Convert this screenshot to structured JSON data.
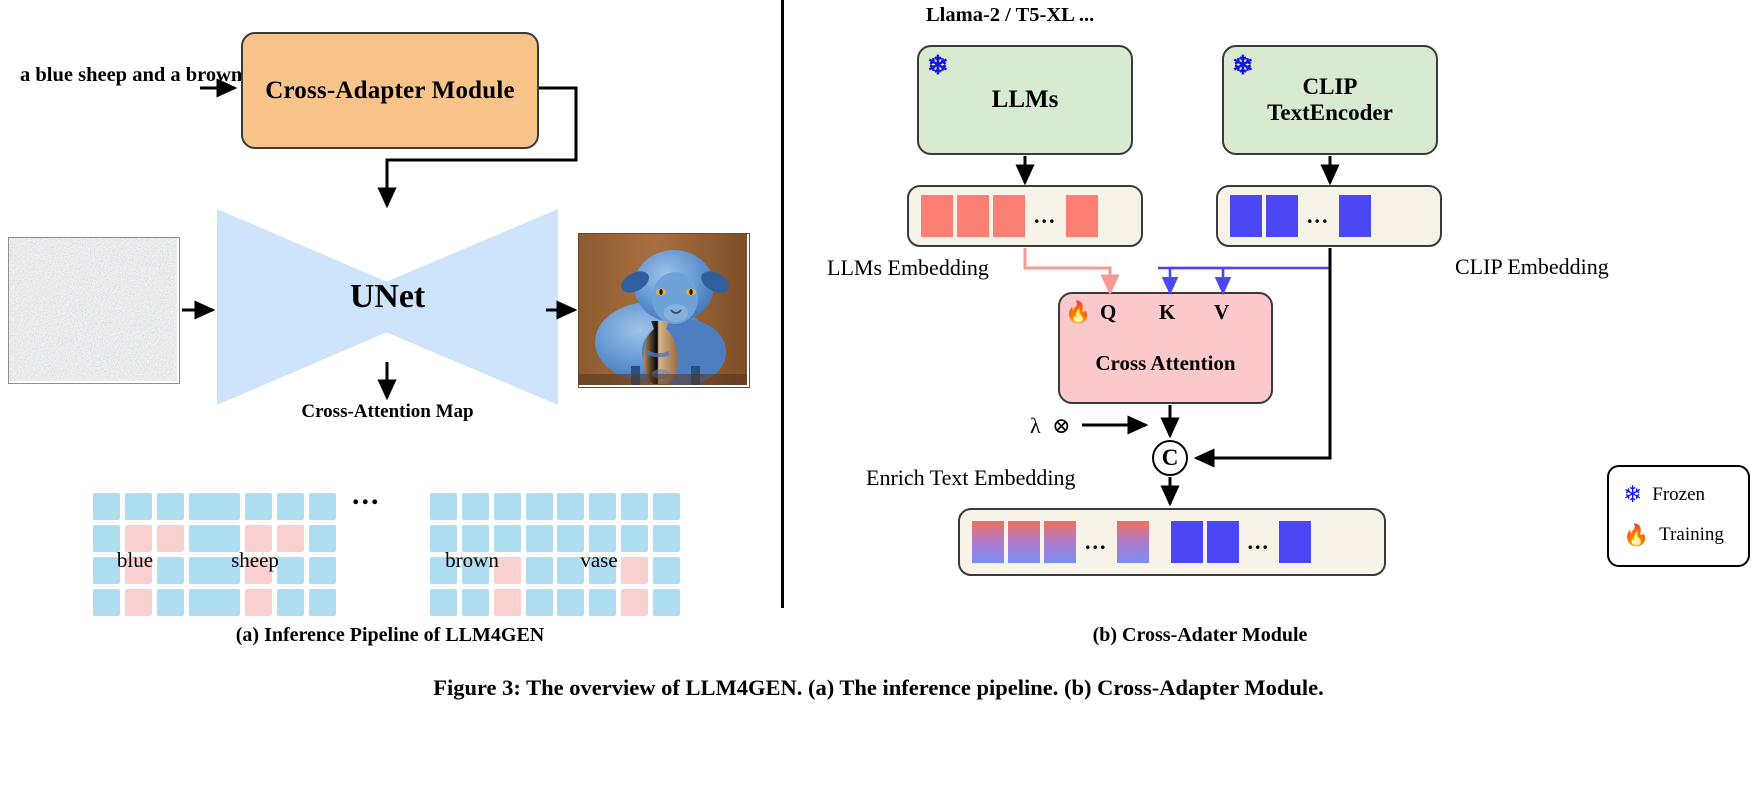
{
  "figure": {
    "caption": "Figure 3: The overview of LLM4GEN. (a) The inference pipeline. (b) Cross-Adapter Module.",
    "panel_a_caption": "(a) Inference Pipeline of LLM4GEN",
    "panel_b_caption": "(b) Cross-Adater Module"
  },
  "panel_a": {
    "prompt": "a blue sheep and a brown vase",
    "adapter_box": "Cross-Adapter Module",
    "unet_label": "UNet",
    "cross_attention_map_label": "Cross-Attention Map",
    "ellipsis": "...",
    "noise_image_alt": "noise-latent",
    "output_image_alt": "blue sheep and brown vase",
    "attention_maps": [
      {
        "word": "blue",
        "rows": [
          [
            0,
            0,
            0,
            0
          ],
          [
            0,
            1,
            1,
            0
          ],
          [
            0,
            1,
            0,
            0
          ],
          [
            0,
            1,
            0,
            0
          ]
        ]
      },
      {
        "word": "sheep",
        "rows": [
          [
            0,
            0,
            0,
            0
          ],
          [
            0,
            1,
            1,
            0
          ],
          [
            0,
            1,
            0,
            0
          ],
          [
            0,
            1,
            0,
            0
          ]
        ]
      },
      {
        "word": "brown",
        "rows": [
          [
            0,
            0,
            0,
            0
          ],
          [
            0,
            0,
            0,
            0
          ],
          [
            0,
            0,
            1,
            0
          ],
          [
            0,
            0,
            1,
            0
          ]
        ]
      },
      {
        "word": "vase",
        "rows": [
          [
            0,
            0,
            0,
            0
          ],
          [
            0,
            0,
            0,
            0
          ],
          [
            0,
            0,
            1,
            0
          ],
          [
            0,
            0,
            1,
            0
          ]
        ]
      }
    ],
    "colors": {
      "adapter_fill": "#f8c48a",
      "unet_fill": "#cde4fa",
      "cell_base": "#aeddf2",
      "cell_highlight": "#fbd0d0"
    }
  },
  "panel_b": {
    "llm_family_label": "Llama-2 / T5-XL ...",
    "llms_box": "LLMs",
    "clip_box": "CLIP\nTextEncoder",
    "clip_box_line1": "CLIP",
    "clip_box_line2": "TextEncoder",
    "llm_embedding_label": "LLMs Embedding",
    "clip_embedding_label": "CLIP Embedding",
    "cross_attention_box": "Cross Attention",
    "q_label": "Q",
    "k_label": "K",
    "v_label": "V",
    "lambda_symbol": "λ",
    "multiply_symbol": "⊗",
    "concat_symbol": "C",
    "enrich_label": "Enrich Text Embedding",
    "dots": "...",
    "legend": [
      {
        "icon": "snowflake-icon",
        "glyph": "❄",
        "label": "Frozen",
        "color": "#1414e6"
      },
      {
        "icon": "fire-icon",
        "glyph": "🔥",
        "label": "Training",
        "color": "#ef6c1f"
      }
    ],
    "llm_tokens": {
      "count": 4,
      "color": "#fb7f72"
    },
    "clip_tokens": {
      "count": 3,
      "color": "#4c47f5"
    },
    "enrich_tokens": {
      "grad_count": 4,
      "blue_count": 3
    },
    "colors": {
      "model_fill": "#d8ead0",
      "bar_fill": "#f7f3e9",
      "attn_fill": "#fbc9cc",
      "llm_arrow": "#f79a96",
      "clip_arrow": "#4c47f5"
    }
  }
}
